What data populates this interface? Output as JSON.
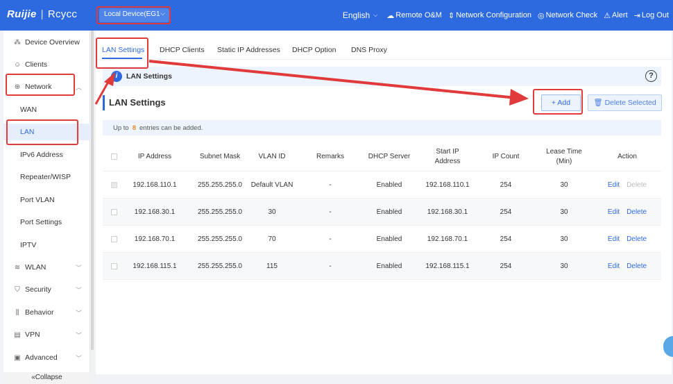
{
  "brand": {
    "logo": "Ruijie",
    "sub": "Rcycc"
  },
  "device_select": {
    "value": "Local Device(EG1"
  },
  "topnav": {
    "language": "English",
    "items": [
      {
        "label": "Remote O&M",
        "icon": "cloud-icon"
      },
      {
        "label": "Network Configuration",
        "icon": "network-config-icon"
      },
      {
        "label": "Network Check",
        "icon": "network-check-icon"
      },
      {
        "label": "Alert",
        "icon": "alert-icon"
      },
      {
        "label": "Log Out",
        "icon": "logout-icon"
      }
    ]
  },
  "sidebar": {
    "items": [
      {
        "label": "Device Overview",
        "icon": "device-overview-icon"
      },
      {
        "label": "Clients",
        "icon": "clients-icon"
      },
      {
        "label": "Network",
        "icon": "globe-icon"
      },
      {
        "label": "WAN"
      },
      {
        "label": "LAN"
      },
      {
        "label": "IPv6 Address"
      },
      {
        "label": "Repeater/WISP"
      },
      {
        "label": "Port VLAN"
      },
      {
        "label": "Port Settings"
      },
      {
        "label": "IPTV"
      },
      {
        "label": "WLAN",
        "icon": "wifi-icon"
      },
      {
        "label": "Security",
        "icon": "shield-icon"
      },
      {
        "label": "Behavior",
        "icon": "behavior-icon"
      },
      {
        "label": "VPN",
        "icon": "vpn-icon"
      },
      {
        "label": "Advanced",
        "icon": "briefcase-icon"
      }
    ],
    "collapse": "«Collapse"
  },
  "tabs": [
    {
      "label": "LAN Settings"
    },
    {
      "label": "DHCP Clients"
    },
    {
      "label": "Static IP Addresses"
    },
    {
      "label": "DHCP Option"
    },
    {
      "label": "DNS Proxy"
    }
  ],
  "info_bar": {
    "badge": "i",
    "label": "LAN Settings",
    "help": "?"
  },
  "section": {
    "title": "LAN Settings"
  },
  "buttons": {
    "add": "+ Add",
    "delete_selected": "Delete Selected"
  },
  "limit": {
    "prefix": "Up to",
    "count": "8",
    "suffix": "entries can be added."
  },
  "table": {
    "headers": [
      "IP Address",
      "Subnet Mask",
      "VLAN ID",
      "Remarks",
      "DHCP Server",
      "Start IP Address",
      "IP Count",
      "Lease Time (Min)",
      "Action"
    ],
    "rows": [
      {
        "ip": "192.168.110.1",
        "mask": "255.255.255.0",
        "vlan": "Default VLAN",
        "remarks": "-",
        "dhcp": "Enabled",
        "start": "192.168.110.1",
        "count": "254",
        "lease": "30",
        "edit": "Edit",
        "delete": "Delete"
      },
      {
        "ip": "192.168.30.1",
        "mask": "255.255.255.0",
        "vlan": "30",
        "remarks": "-",
        "dhcp": "Enabled",
        "start": "192.168.30.1",
        "count": "254",
        "lease": "30",
        "edit": "Edit",
        "delete": "Delete"
      },
      {
        "ip": "192.168.70.1",
        "mask": "255.255.255.0",
        "vlan": "70",
        "remarks": "-",
        "dhcp": "Enabled",
        "start": "192.168.70.1",
        "count": "254",
        "lease": "30",
        "edit": "Edit",
        "delete": "Delete"
      },
      {
        "ip": "192.168.115.1",
        "mask": "255.255.255.0",
        "vlan": "115",
        "remarks": "-",
        "dhcp": "Enabled",
        "start": "192.168.115.1",
        "count": "254",
        "lease": "30",
        "edit": "Edit",
        "delete": "Delete"
      }
    ]
  },
  "colors": {
    "primary": "#2d6ae0",
    "annotation": "#e03a3a",
    "count_highlight": "#f0891c"
  }
}
